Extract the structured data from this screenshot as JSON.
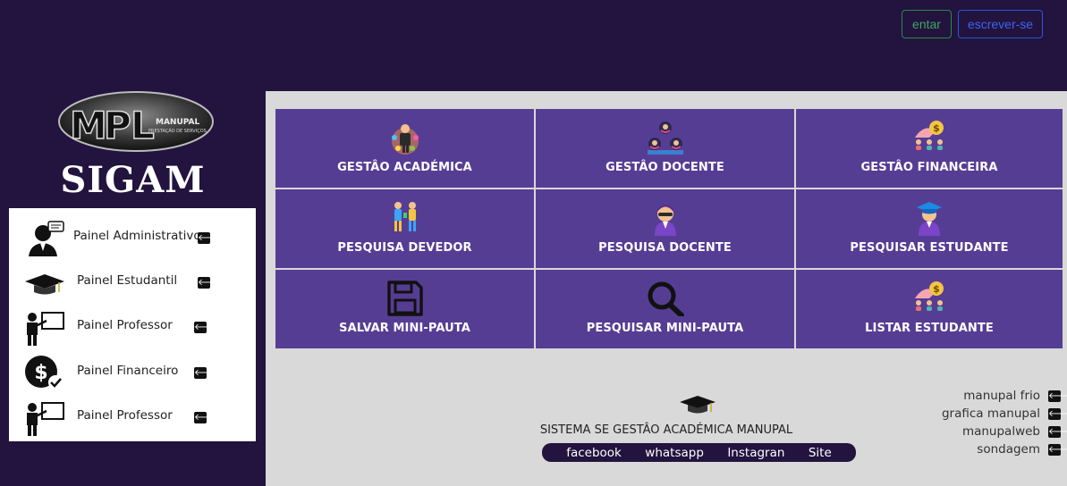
{
  "header": {
    "login_label": "entar",
    "signup_label": "escrever-se"
  },
  "brand": {
    "logo_text": "MPL",
    "logo_subtext_1": "MANUPAL",
    "logo_subtext_2": "PRESTAÇÃO DE SERVIÇOS",
    "title": "SIGAM"
  },
  "sidebar": {
    "items": [
      {
        "label": "Painel Administrativo",
        "icon": "admin-icon"
      },
      {
        "label": "Painel Estudantil",
        "icon": "graduation-cap-icon"
      },
      {
        "label": "Painel Professor",
        "icon": "teacher-board-icon"
      },
      {
        "label": "Painel Financeiro",
        "icon": "dollar-check-icon"
      },
      {
        "label": "Painel Professor",
        "icon": "teacher-board-icon"
      }
    ],
    "arrow_glyph": "🡐"
  },
  "tiles": [
    {
      "label": "GESTÂO ACADÉMICA",
      "icon": "academic-icon"
    },
    {
      "label": "GESTÂO DOCENTE",
      "icon": "teachers-group-icon"
    },
    {
      "label": "GESTÂO FINANCEIRA",
      "icon": "finance-icon"
    },
    {
      "label": "PESQUISA DEVEDOR",
      "icon": "debtor-icon"
    },
    {
      "label": "PESQUISA DOCENTE",
      "icon": "teacher-search-icon"
    },
    {
      "label": "PESQUISAR ESTUDANTE",
      "icon": "student-icon"
    },
    {
      "label": "SALVAR MINI-PAUTA",
      "icon": "save-icon"
    },
    {
      "label": "PESQUISAR MINI-PAUTA",
      "icon": "magnifier-icon"
    },
    {
      "label": "LISTAR ESTUDANTE",
      "icon": "finance-icon"
    }
  ],
  "footer": {
    "title": "SISTEMA SE GESTÂO ACADÉMICA MANUPAL",
    "social": [
      "facebook",
      "whatsapp",
      "Instagran",
      "Site"
    ]
  },
  "right_links": [
    "manupal frio",
    "grafica manupal",
    "manupalweb",
    "sondagem"
  ],
  "colors": {
    "background": "#22133f",
    "tile": "#563d94",
    "main_bg": "#d9d9d9",
    "login": "#3fa85e",
    "signup": "#3b66ef"
  }
}
